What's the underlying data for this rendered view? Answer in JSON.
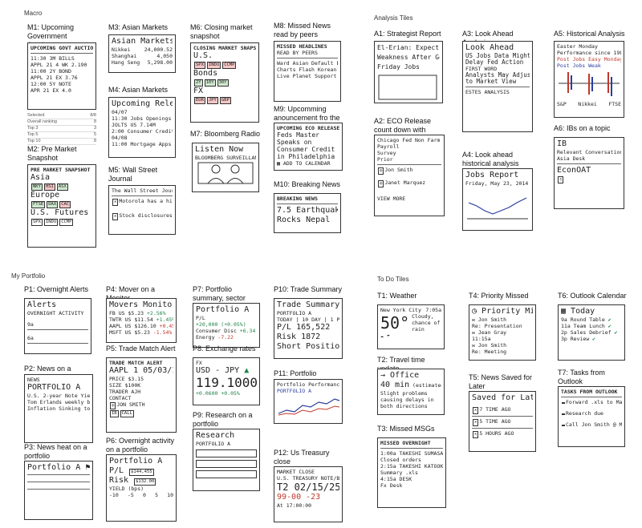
{
  "sections": {
    "macro": "Macro",
    "analysis": "Analysis Tiles",
    "portfolio": "My Portfolio",
    "todo": "To Do Tiles"
  },
  "tiles": {
    "m1": {
      "title": "M1: Upcoming Government Auctions",
      "lines": [
        "UPCOMING GOVT AUCTIONS",
        "11:30 3M BILLS",
        "APPL 21 4 WK 2.190",
        "11:00 2Y BOND",
        "APPL 21 EX 3.76",
        "12:00 5Y NOTE",
        "APR 21 EX 4.0"
      ],
      "selected": "Selected",
      "selected_val": "8/8",
      "overall": "Overall ranking",
      "overall_val": "8",
      "top3": "Top 3",
      "top3_val": "3",
      "top5": "Top 5",
      "top5_val": "5",
      "top10": "Top 10",
      "top10_val": "8"
    },
    "m2": {
      "title": "M2: Pre Market Snapshot",
      "header": "PRE MARKET SNAPSHOT",
      "asia": "Asia",
      "europe": "Europe",
      "us": "U.S. Futures",
      "asia_boxes": [
        "NKY",
        "HSI",
        "ASX"
      ],
      "eu_boxes": [
        "FTSE",
        "DAX",
        "CAC"
      ],
      "us_boxes": [
        "SPX",
        "INDU",
        "CCMP"
      ]
    },
    "m3": {
      "title": "M3: Asian Markets",
      "header": "Asian Markets",
      "rows": [
        [
          "Nikkei",
          "24,000.52"
        ],
        [
          "Shanghai",
          "4,050"
        ],
        [
          "Hang Seng",
          "5,298.00"
        ]
      ]
    },
    "m4": {
      "title": "M4: Asian Markets",
      "header": "Upcoming Releases",
      "lines": [
        "04/07",
        "11:30 Jobs Openings",
        "JOLTS US 7.14M",
        "2:00 Consumer Credit",
        "04/08",
        "11:00 Mortgage Apps"
      ]
    },
    "m5": {
      "title": "M5: Wall Street Journal",
      "header": "The Wall Street Journal",
      "lines": [
        "Motorola has a hit in Brazil",
        "Stock disclosures breach about $160"
      ]
    },
    "m6": {
      "title": "M6: Closing market snapshot",
      "header": "CLOSING MARKET SNAPSHOT",
      "us": "U.S.",
      "bonds": "Bonds",
      "fx": "FX",
      "us_boxes": [
        "SPX",
        "INDU",
        "CCMP"
      ],
      "bond_boxes": [
        "2Y",
        "10Y",
        "30Y"
      ],
      "fx_boxes": [
        "EUR",
        "JPY",
        "GBP"
      ]
    },
    "m7": {
      "title": "M7: Bloomberg Radio",
      "header": "Listen Now",
      "sub": "BLOOMBERG SURVEILLANCE"
    },
    "m8": {
      "title": "M8: Missed News read by peers",
      "header": "MISSED HEADLINES",
      "sub": "READ BY PEERS",
      "lines": [
        "Ward Asian Default Engineers... Bloomberg",
        "Charts Flash Korean Bond Sell-Offs",
        "Live Planet Support Stream Gets..."
      ]
    },
    "m9": {
      "title": "M9: Upcomming anouncement fro the",
      "header": "UPCOMING ECO RELEASE",
      "big": "Feds Master Speaks on Consumer Credit in Philadelphia",
      "action": "ADD TO CALENDAR"
    },
    "m10": {
      "title": "M10: Breaking News",
      "header": "BREAKING NEWS",
      "lines": [
        "7.5 Earthquake",
        "Rocks Nepal"
      ]
    },
    "a1": {
      "title": "A1: Strategist Report",
      "lines": [
        "El-Erian: Expect Mon.",
        "Weakness After Good",
        "Friday Jobs"
      ]
    },
    "a2": {
      "title": "A2: ECO Release count down with strategist",
      "lines": [
        "Chicago Fed Non Farm",
        "Payroll",
        "Survey",
        "Prior"
      ],
      "people": [
        "Jon Smith",
        "Janet Marquez"
      ],
      "action": "VIEW MORE"
    },
    "a3": {
      "title": "A3: Look Ahead Analysis",
      "header": "Look Ahead",
      "lines": [
        "US Jobs Data Might",
        "Delay Fed Action",
        "FIRST WORD",
        "Analysts May Adjust",
        "to Market View"
      ],
      "footer": "ESTES ANALYSIS"
    },
    "a4": {
      "title": "A4: Look ahead historical analysis",
      "header": "Jobs Report",
      "sub": "Friday, May 23, 2014"
    },
    "a5": {
      "title": "A5: Historical Analysis",
      "lines": [
        "Easter Monday",
        "Performance since 1980"
      ],
      "legend": [
        "Post Jobs Easy Monday",
        "Post Jobs Weak"
      ],
      "axis": [
        "S&P",
        "Nikkei",
        "FTSE"
      ]
    },
    "a6": {
      "title": "A6: IBs on a topic",
      "lines": [
        "IB",
        "Relevant Conversations",
        "Asia Desk",
        "EconOAT"
      ]
    },
    "p1": {
      "title": "P1: Overnight Alerts",
      "header": "Alerts",
      "sub": "OVERNIGHT ACTIVITY",
      "labels": [
        "9a",
        "6a",
        "4a"
      ]
    },
    "p2": {
      "title": "P2: News on a Portfolio",
      "header": "NEWS",
      "portfolio": "PORTFOLIO A",
      "lines": [
        "U.S. 2-year Note Yield Climbs...",
        "Tom Erlands weekly bank dan...",
        "Inflation Sinking to Slowest Rate"
      ]
    },
    "p3": {
      "title": "P3: News heat on a portfolio",
      "header": "Portfolio A",
      "sub": "heat"
    },
    "p4": {
      "title": "P4: Mover on a Monitor",
      "header": "Movers Monitor A",
      "rows": [
        [
          "FB US",
          "$5.23",
          "+2.56%"
        ],
        [
          "TWTR US",
          "$11.54",
          "+1.45%"
        ],
        [
          "AAPL US",
          "$126.10",
          "+0.45%"
        ],
        [
          "MSFT US",
          "$5.23",
          "-1.54%"
        ]
      ]
    },
    "p5": {
      "title": "P5: Trade Match Alert",
      "header": "TRADE MATCH ALERT",
      "big": "AAPL 1 05/03/18",
      "rows": [
        [
          "PRICE",
          "$3.15"
        ],
        [
          "SIZE",
          "$100K"
        ],
        [
          "TRADER",
          "AJH"
        ]
      ],
      "contact": "CONTACT",
      "person": "JON SMITH",
      "actions": [
        "IB",
        "CALL"
      ]
    },
    "p6": {
      "title": "P6: Overnight activity on a portfolio",
      "header": "Portfolio A",
      "rows": [
        [
          "P/L",
          "$144,455"
        ],
        [
          "Risk",
          "$132.00"
        ]
      ],
      "yield": "YIELD (bps)",
      "scale": [
        "-10",
        "-5",
        "0",
        "5",
        "10"
      ]
    },
    "p7": {
      "title": "P7: Portfolio summary, sector leaders and",
      "header": "Portfolio A",
      "pl": "P/L",
      "pl_val": "+20,000 (+0.05%)",
      "rows": [
        [
          "Consumer Disc",
          "+6.34"
        ],
        [
          "Energy",
          "-7.22"
        ]
      ]
    },
    "p8": {
      "title": "P8: Exchange rates",
      "header": "FX",
      "pair": "USD - JPY",
      "big": "119.1000",
      "change": "+0.0600",
      "pct": "+0.05%"
    },
    "p9": {
      "title": "P9: Research on a portfolio",
      "header": "Research",
      "sub": "PORTFOLIO A"
    },
    "p10": {
      "title": "P10: Trade Summary",
      "header": "Trade Summary",
      "sub": "PORTFOLIO A",
      "rows": [
        [
          "TODAY",
          "10 DAY",
          "1 PRM"
        ],
        [
          "P/L",
          "165,522",
          ""
        ],
        [
          "Risk",
          "1872",
          ""
        ]
      ],
      "footer": "Short Positions"
    },
    "p11": {
      "title": "P11: Portfolio Performance",
      "header": "Portfolio Performance",
      "legend": "PORTFOLIO A"
    },
    "p12": {
      "title": "P12: Us Treasury close",
      "header": "MARKET CLOSE",
      "sub": "U.S. TREASURY NOTE/BOND",
      "big": "T2 02/15/25",
      "price": "99-00 -23",
      "time": "At 17:00:00"
    },
    "t1": {
      "title": "T1: Weather",
      "city": "New York City",
      "time": "7:05a",
      "temp": "50°",
      "desc": "Cloudy, chance of rain"
    },
    "t2": {
      "title": "T2: Travel time update",
      "dest": "Office",
      "mins": "40 min",
      "est": "(estimated)",
      "note": "Slight problems causing delays in both directions"
    },
    "t3": {
      "title": "T3: Missed MSGs",
      "header": "MISSED OVERNIGHT",
      "rows": [
        [
          "1:00a",
          "TAKESHI SUMASAKI",
          "Closed orders"
        ],
        [
          "2:15a",
          "TAKESHI KATOOKA",
          "Summary .xls"
        ],
        [
          "4:15a",
          "DESK",
          "Fx Desk"
        ]
      ]
    },
    "t4": {
      "title": "T4: Priority Missed",
      "header": "Priority Missed",
      "rows": [
        [
          "Jon Smith",
          "Re: Presentation"
        ],
        [
          "Jean Gray",
          "11:15a"
        ],
        [
          "Jon Smith",
          "Re: Meeting"
        ]
      ]
    },
    "t5": {
      "title": "T5: News Saved for Later",
      "header": "Saved for Later",
      "rows": [
        "7 TIME AGO",
        "5 TIME AGO",
        "5 HOURS AGO"
      ]
    },
    "t6": {
      "title": "T6: Outlook Calendar",
      "header": "Today",
      "rows": [
        [
          "9a",
          "Round Table"
        ],
        [
          "11a",
          "Team Lunch"
        ],
        [
          "2p",
          "Sales Debrief"
        ],
        [
          "3p",
          "Review"
        ]
      ]
    },
    "t7": {
      "title": "T7: Tasks from Outlook",
      "header": "TASKS FROM OUTLOOK",
      "rows": [
        "Forward .xls to Max",
        "Research due",
        "Call Jon Smith @ MBC"
      ]
    }
  }
}
